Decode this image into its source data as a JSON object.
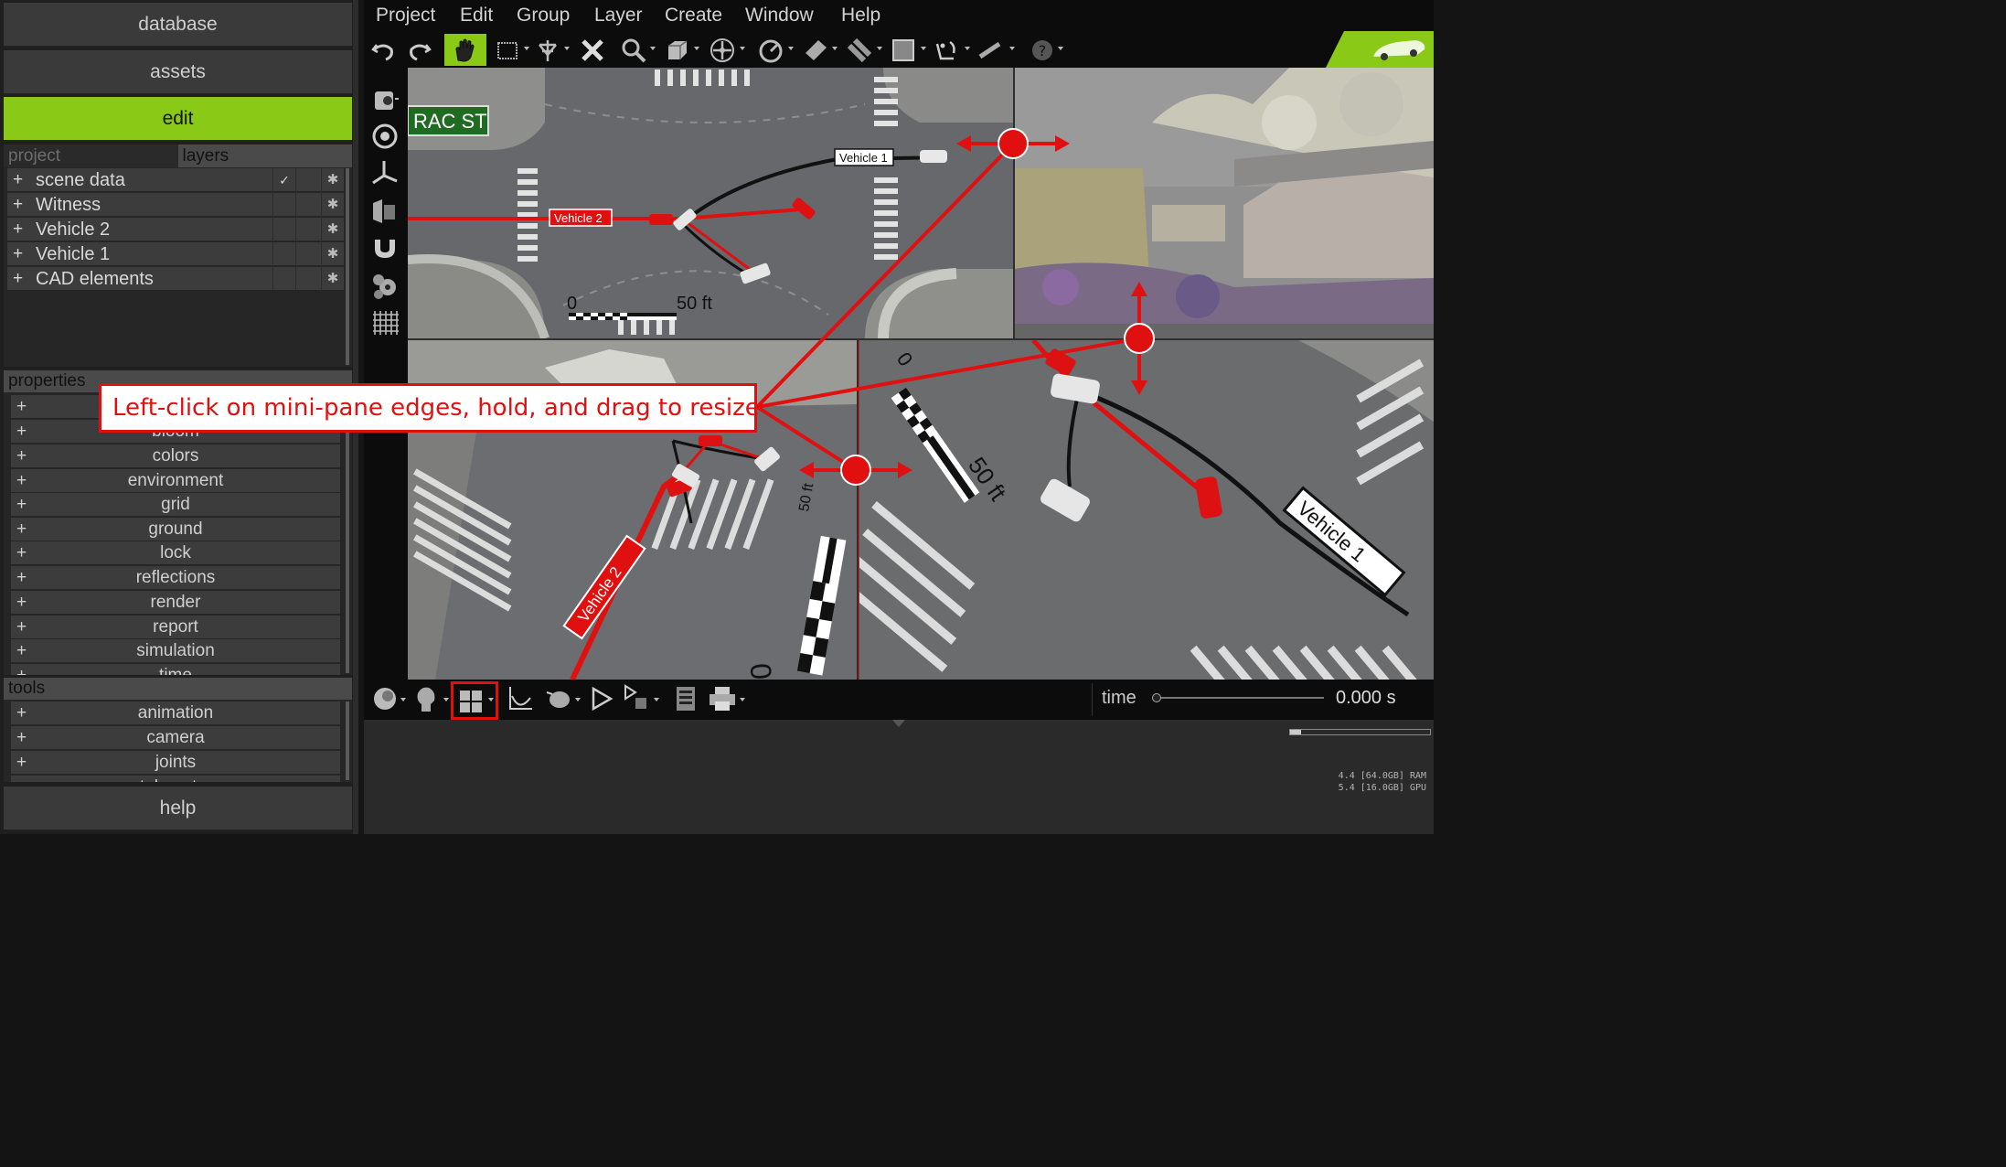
{
  "left_panel": {
    "database_label": "database",
    "assets_label": "assets",
    "edit_label": "edit",
    "help_label": "help",
    "tabs": {
      "project": "project",
      "layers": "layers"
    },
    "layers": [
      {
        "label": "scene data",
        "checked": "✓"
      },
      {
        "label": "Witness",
        "checked": ""
      },
      {
        "label": "Vehicle 2",
        "checked": ""
      },
      {
        "label": "Vehicle 1",
        "checked": ""
      },
      {
        "label": "CAD elements",
        "checked": ""
      }
    ],
    "properties_header": "properties",
    "properties": [
      "",
      "bloom",
      "colors",
      "environment",
      "grid",
      "ground",
      "lock",
      "reflections",
      "render",
      "report",
      "simulation",
      "time"
    ],
    "tools_header": "tools",
    "tools": [
      "animation",
      "camera",
      "joints",
      "telemetry"
    ]
  },
  "menu": [
    "Project",
    "Edit",
    "Group",
    "Layer",
    "Create",
    "Window",
    "Help"
  ],
  "toolbar_icons": [
    "undo-icon",
    "redo-icon",
    "hand-icon",
    "select-icon",
    "pin-icon",
    "delete-icon",
    "zoom-icon",
    "box-icon",
    "move-icon",
    "gauge-icon",
    "ruler-icon",
    "tube-icon",
    "plane-icon",
    "bend-icon",
    "measure-icon",
    "help-icon"
  ],
  "viewport": {
    "street_sign": "RAC ST",
    "vehicle1_label": "Vehicle 1",
    "vehicle2_label": "Vehicle 2",
    "scale_zero": "0",
    "scale_end": "50 ft"
  },
  "callout_text": "Left-click on mini-pane edges, hold, and drag to resize",
  "bottom": {
    "time_label": "time",
    "time_value": "0.000 s",
    "ram": "4.4 [64.0GB] RAM",
    "gpu": "5.4 [16.0GB] GPU"
  },
  "colors": {
    "accent_green": "#8ac915",
    "annotation_red": "#e01010"
  }
}
